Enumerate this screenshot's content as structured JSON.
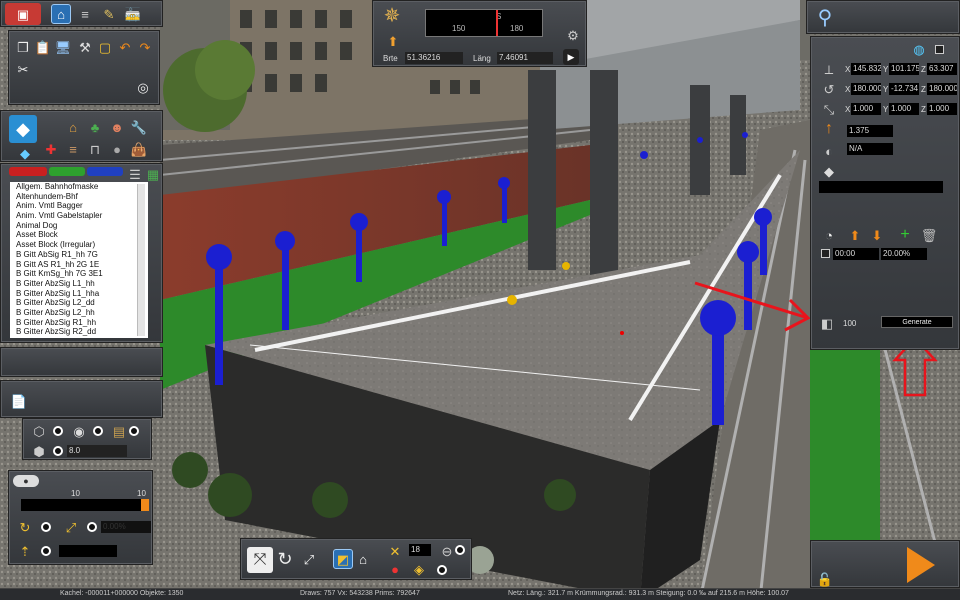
{
  "compass": {
    "heading_ticks": [
      "150",
      "S",
      "180"
    ],
    "breite_label": "Brte",
    "breite": "51.36216",
    "laenge_label": "Läng",
    "laenge": "7.46091"
  },
  "object_list": {
    "items": [
      "Allgem. Bahnhofmaske",
      "Altenhundem-Bhf",
      "Anim. Vmtl Bagger",
      "Anim. Vmtl Gabelstapler",
      "Animal Dog",
      "Asset Block",
      "Asset Block (Irregular)",
      "B Gitt AbSig R1_hh 7G",
      "B Gitt AS R1_hh 2G 1E",
      "B Gitt KmSg_hh 7G 3E1",
      "B Gitter AbzSig L1_hh",
      "B Gitter AbzSig L1_hha",
      "B Gitter AbzSig L2_dd",
      "B Gitter AbzSig L2_hh",
      "B Gitter AbzSig R1_hh",
      "B Gitter AbzSig R2_dd"
    ]
  },
  "left_tools": {
    "spacing_value": "8.0",
    "slider_min": "10",
    "slider_max": "10",
    "field_value": "0.00%"
  },
  "properties": {
    "pos": {
      "x_label": "X",
      "x": "145.832",
      "y_label": "Y",
      "y": "101.175",
      "z_label": "Z",
      "z": "63.307"
    },
    "rot": {
      "x_label": "X",
      "x": "180.000",
      "y_label": "Y",
      "y": "-12.734",
      "z_label": "Z",
      "z": "180.000"
    },
    "scale": {
      "x_label": "X",
      "x": "1.000",
      "y_label": "Y",
      "y": "1.000",
      "z_label": "Z",
      "z": "1.000"
    },
    "height": "1.375",
    "link": "N/A",
    "time": "00:00",
    "percent": "20.00%",
    "count": "100",
    "generate_label": "Generate"
  },
  "bottom_toolbar": {
    "counter": "18"
  },
  "status": {
    "left": "Kachel: -000011+000000  Objekte: 1350",
    "mid": "Draws: 757 Vx: 543238 Prims: 792647",
    "right": "Netz:  Läng.: 321.7 m Krümmungsrad.: 931.3 m Steigung: 0.0 ‰ auf 215.6 m Höhe: 100.07"
  },
  "colors": {
    "accent": "#2a6fb3",
    "annotation": "#e8141c",
    "panel": "#3f4246",
    "orange": "#f08a1a"
  }
}
